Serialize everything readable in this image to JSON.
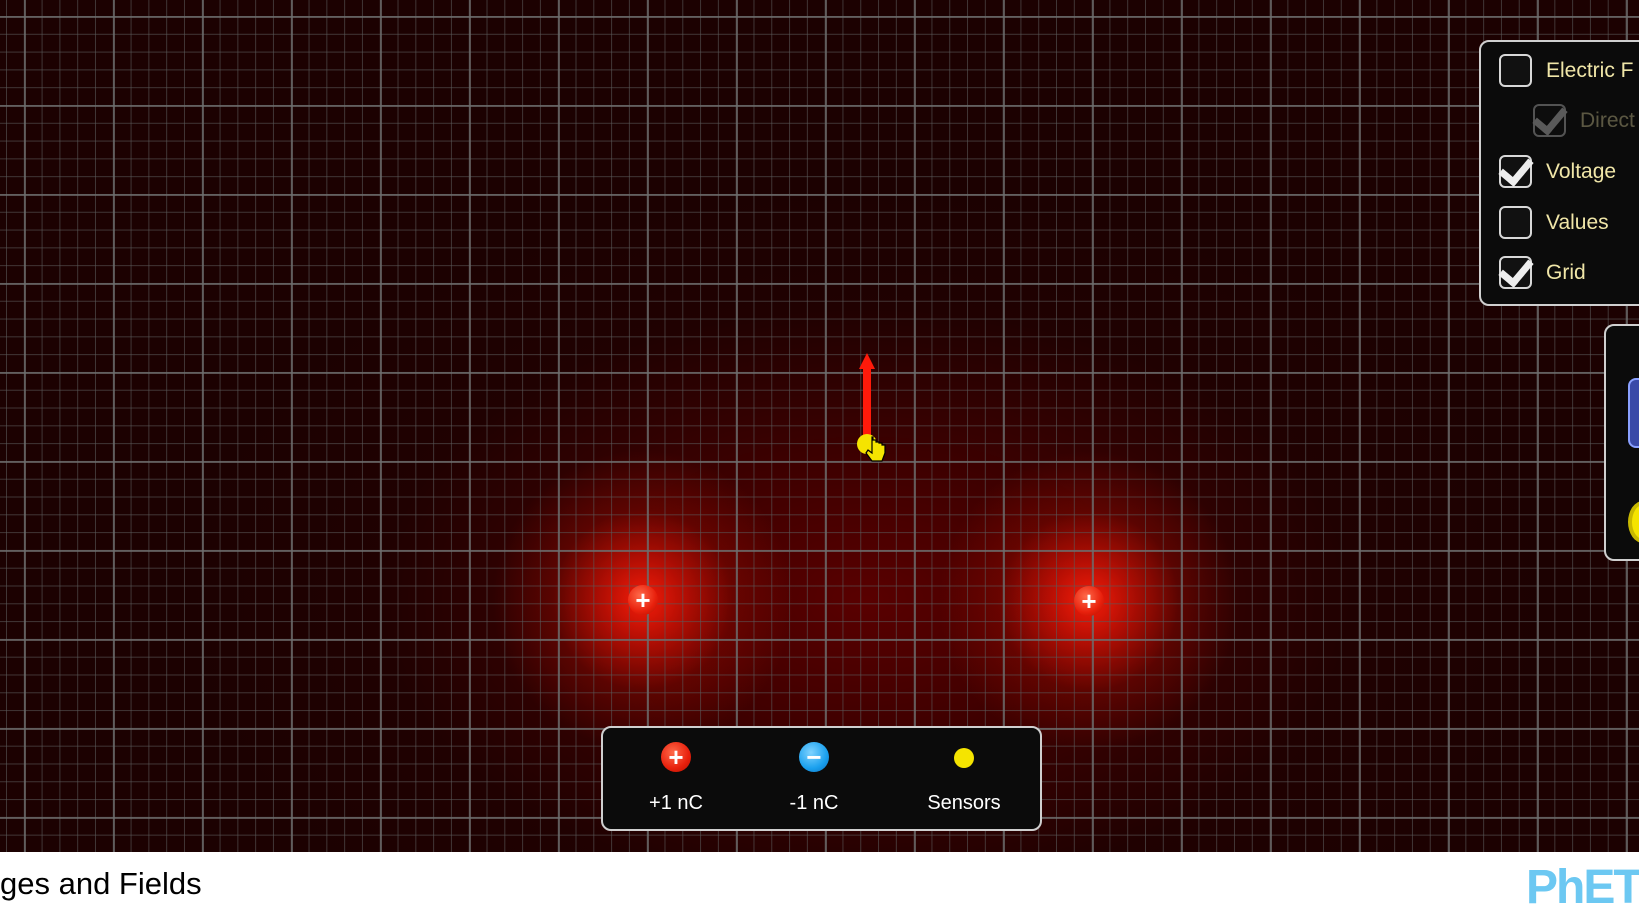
{
  "sim": {
    "title_visible": "ges and Fields",
    "logo": "PhET"
  },
  "controls": {
    "items": [
      {
        "label": "Electric F",
        "checked": false,
        "enabled": true
      },
      {
        "label": "Direct",
        "checked": true,
        "enabled": false
      },
      {
        "label": "Voltage",
        "checked": true,
        "enabled": true
      },
      {
        "label": "Values",
        "checked": false,
        "enabled": true
      },
      {
        "label": "Grid",
        "checked": true,
        "enabled": true
      }
    ]
  },
  "toolbox": {
    "positive": "+1 nC",
    "negative": "-1 nC",
    "sensors": "Sensors"
  },
  "charges": [
    {
      "sign": "+"
    },
    {
      "sign": "+"
    }
  ],
  "colors": {
    "positive": "#e8200c",
    "negative": "#1aa0ee",
    "sensor": "#f5e400",
    "field_arrow": "#ff1a0a",
    "label": "#f0e6a8"
  }
}
